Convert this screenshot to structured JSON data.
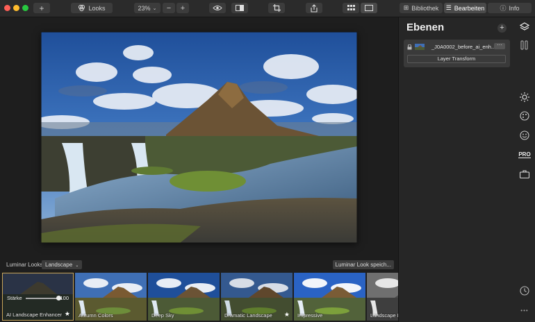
{
  "toolbar": {
    "looks_label": "Looks",
    "zoom": "23%",
    "zoom_minus": "−",
    "zoom_plus": "+",
    "add_label": "+",
    "tabs": [
      {
        "label": "Bibliothek",
        "icon": "library-icon"
      },
      {
        "label": "Bearbeiten",
        "icon": "sliders-icon"
      },
      {
        "label": "Info",
        "icon": "info-icon"
      }
    ],
    "active_tab": "Bearbeiten"
  },
  "looks": {
    "label": "Luminar Looks:",
    "category": "Landscape",
    "save_label": "Luminar Look speich...",
    "items": [
      {
        "name": "AI Landscape Enhancer",
        "favorite": true,
        "selected": true
      },
      {
        "name": "Autumn Colors",
        "favorite": false
      },
      {
        "name": "Deep Sky",
        "favorite": false
      },
      {
        "name": "Dramatic Landscape",
        "favorite": true
      },
      {
        "name": "Impressive",
        "favorite": false
      },
      {
        "name": "Landscape B",
        "favorite": false
      }
    ],
    "strength_label": "Stärke",
    "strength_value": "100"
  },
  "panel": {
    "title": "Ebenen",
    "add_label": "+",
    "layer": {
      "name": "_J0A0002_before_ai_enh...",
      "more_label": "···",
      "transform_label": "Layer Transform"
    }
  },
  "rail_icons": [
    "layers-icon",
    "histogram-icon",
    "sun-icon",
    "palette-icon",
    "smiley-icon",
    "pro-icon",
    "briefcase-icon",
    "clock-icon",
    "more-icon"
  ],
  "rail": {
    "pro_label": "PRO",
    "more_label": "•••"
  },
  "colors": {
    "accent_selected": "#c9a65a",
    "close": "#fe5f57",
    "minimize": "#febc2e",
    "maximize": "#28c840"
  }
}
